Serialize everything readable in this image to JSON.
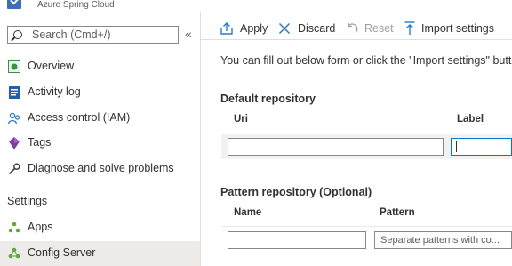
{
  "header": {
    "subtitle": "Azure Spring Cloud"
  },
  "sidebar": {
    "search_placeholder": "Search (Cmd+/)",
    "collapse_glyph": "«",
    "items": [
      {
        "label": "Overview",
        "icon": "overview-icon"
      },
      {
        "label": "Activity log",
        "icon": "activity-log-icon"
      },
      {
        "label": "Access control (IAM)",
        "icon": "iam-icon"
      },
      {
        "label": "Tags",
        "icon": "tag-icon"
      },
      {
        "label": "Diagnose and solve problems",
        "icon": "wrench-icon"
      }
    ],
    "section_label": "Settings",
    "settings_items": [
      {
        "label": "Apps",
        "icon": "apps-icon"
      },
      {
        "label": "Config Server",
        "icon": "config-server-icon",
        "selected": true
      }
    ]
  },
  "toolbar": {
    "apply": "Apply",
    "discard": "Discard",
    "reset": "Reset",
    "import": "Import settings"
  },
  "main": {
    "intro": "You can fill out below form or click the \"Import settings\" button",
    "default_repo": {
      "title": "Default repository",
      "col_uri": "Uri",
      "col_label": "Label",
      "uri_value": "",
      "label_value": ""
    },
    "pattern_repo": {
      "title": "Pattern repository (Optional)",
      "col_name": "Name",
      "col_pattern": "Pattern",
      "name_value": "",
      "pattern_placeholder": "Separate patterns with co..."
    }
  },
  "colors": {
    "accent": "#0078d4",
    "selected_bg": "#edebe9",
    "text": "#323130"
  }
}
